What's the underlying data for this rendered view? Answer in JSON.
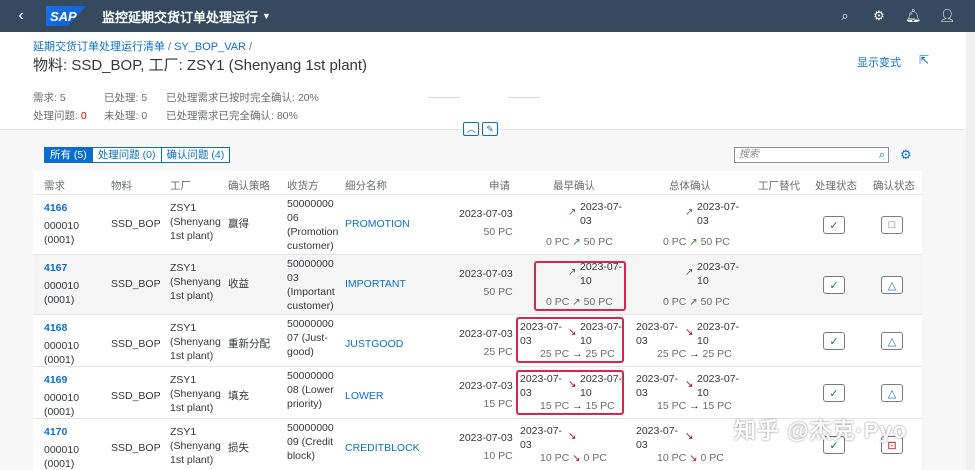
{
  "shell": {
    "logo": "SAP",
    "title": "监控延期交货订单处理运行",
    "icons": [
      "search-icon",
      "gear-icon",
      "bell-icon",
      "user-icon"
    ]
  },
  "header": {
    "breadcrumb": [
      "延期交货订单处理运行清单",
      "SY_BOP_VAR"
    ],
    "title": "物料: SSD_BOP, 工厂: ZSY1 (Shenyang 1st plant)",
    "variant_link": "显示变式",
    "kpis": {
      "demand": "需求: 5",
      "processed": "已处理: 5",
      "processed_confirmed_on_time": "已处理需求已按时完全确认: 20%",
      "issues_label": "处理问题: ",
      "issues_value": "0",
      "unprocessed": "未处理: 0",
      "processed_fully_confirmed": "已处理需求已完全确认: 80%"
    }
  },
  "toolbar": {
    "tabs": [
      "所有 (5)",
      "处理问题 (0)",
      "确认问题 (4)"
    ],
    "search_placeholder": "搜索"
  },
  "table": {
    "columns": [
      "需求",
      "物料",
      "工厂",
      "确认策略",
      "收货方",
      "细分名称",
      "申请",
      "最早确认",
      "总体确认",
      "工厂替代",
      "处理状态",
      "确认状态"
    ],
    "rows": [
      {
        "id": "4166",
        "item1": "000010",
        "item2": "(0001)",
        "material": "SSD_BOP",
        "plant": [
          "ZSY1",
          "(Shenyang",
          "1st plant)"
        ],
        "strategy": "赢得",
        "receiver": [
          "50000000",
          "06",
          "(Promotion",
          "customer)"
        ],
        "segment": "PROMOTION",
        "req_date": "2023-07-03",
        "req_qty": "50",
        "earliest_date": [
          "2023-07-",
          "03"
        ],
        "earliest_from": "0",
        "earliest_to": "50",
        "overall_date": [
          "2023-07-",
          "03"
        ],
        "overall_from": "0",
        "overall_to": "50",
        "proc_status": "✓",
        "conf_status": "□"
      },
      {
        "id": "4167",
        "item1": "000010",
        "item2": "(0001)",
        "material": "SSD_BOP",
        "plant": [
          "ZSY1",
          "(Shenyang",
          "1st plant)"
        ],
        "strategy": "收益",
        "receiver": [
          "50000000",
          "03",
          "(Important",
          "customer)"
        ],
        "segment": "IMPORTANT",
        "req_date": "2023-07-03",
        "req_qty": "50",
        "earliest_date": [
          "2023-07-",
          "10"
        ],
        "earliest_from": "0",
        "earliest_to": "50",
        "overall_date": [
          "2023-07-",
          "10"
        ],
        "overall_from": "0",
        "overall_to": "50",
        "proc_status": "✓",
        "conf_status": "△"
      },
      {
        "id": "4168",
        "item1": "000010",
        "item2": "(0001)",
        "material": "SSD_BOP",
        "plant": [
          "ZSY1",
          "(Shenyang",
          "1st plant)"
        ],
        "strategy": "重新分配",
        "receiver": [
          "50000000",
          "07 (Just-",
          "good)"
        ],
        "segment": "JUSTGOOD",
        "req_date": "2023-07-03",
        "req_qty": "25",
        "earliest_old": [
          "2023-07-",
          "03"
        ],
        "earliest_date": [
          "2023-07-",
          "10"
        ],
        "earliest_from": "25",
        "earliest_to": "25",
        "overall_old": [
          "2023-07-",
          "03"
        ],
        "overall_date": [
          "2023-07-",
          "10"
        ],
        "overall_from": "25",
        "overall_to": "25",
        "proc_status": "✓",
        "conf_status": "△"
      },
      {
        "id": "4169",
        "item1": "000010",
        "item2": "(0001)",
        "material": "SSD_BOP",
        "plant": [
          "ZSY1",
          "(Shenyang",
          "1st plant)"
        ],
        "strategy": "填充",
        "receiver": [
          "50000000",
          "08 (Lower",
          "priority)"
        ],
        "segment": "LOWER",
        "req_date": "2023-07-03",
        "req_qty": "15",
        "earliest_old": [
          "2023-07-",
          "03"
        ],
        "earliest_date": [
          "2023-07-",
          "10"
        ],
        "earliest_from": "15",
        "earliest_to": "15",
        "overall_old": [
          "2023-07-",
          "03"
        ],
        "overall_date": [
          "2023-07-",
          "10"
        ],
        "overall_from": "15",
        "overall_to": "15",
        "proc_status": "✓",
        "conf_status": "△"
      },
      {
        "id": "4170",
        "item1": "000010",
        "item2": "(0001)",
        "material": "SSD_BOP",
        "plant": [
          "ZSY1",
          "(Shenyang",
          "1st plant)"
        ],
        "strategy": "损失",
        "receiver": [
          "50000000",
          "09 (Credit",
          "block)"
        ],
        "segment": "CREDITBLOCK",
        "req_date": "2023-07-03",
        "req_qty": "10",
        "earliest_old": [
          "2023-07-",
          "03"
        ],
        "earliest_from": "10",
        "earliest_to": "0",
        "overall_old": [
          "2023-07-",
          "03"
        ],
        "overall_from": "10",
        "overall_to": "0",
        "proc_status": "✓",
        "conf_status": "⊡"
      }
    ],
    "unit": "PC"
  },
  "watermark": "知乎 @杰克·Pyo"
}
